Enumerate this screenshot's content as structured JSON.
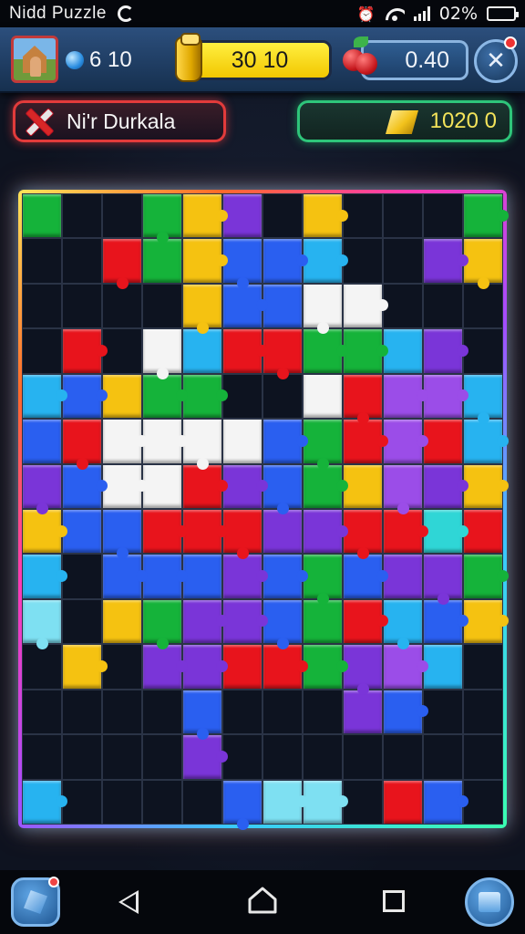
{
  "status_bar": {
    "app_title": "Nidd Puzzle",
    "battery_text": "02%"
  },
  "hud": {
    "coin_count": "6  10",
    "gold_value": "30 10",
    "berry_value": "0.40"
  },
  "level": {
    "name": "Ni'r Durkala"
  },
  "score": {
    "value": "1020 0"
  },
  "colors": {
    "board_bg": "#111827",
    "palette": {
      "R": "#e8141c",
      "G": "#15b33a",
      "B": "#2a5ff0",
      "C": "#27b3f0",
      "P": "#7a35d8",
      "V": "#9b4de8",
      "Y": "#f5c211",
      "W": "#f4f4f4",
      "L": "#7ee0f2",
      "K": "#0d1320",
      "A": "#2fd6d6",
      "T": "#8be02c"
    }
  },
  "board": {
    "columns": 12,
    "rows": 14,
    "cells": [
      "GKKGYPKYKKKG",
      "KKRGYBBCKKPY",
      "KKKKYBBWWKKK",
      "KRKWCRRGGCPK",
      "CBYGGKKWRVVC",
      "BRWWWWBGRVRC",
      "PBWWRPBGYVPY",
      "YBBRRRPPRRAR",
      "CKBBBPBGBPPG",
      "LKYGPPBGRCBY",
      "KYKPPRRGPVCK",
      "KKKKBKKKPBKK",
      "KKKKPKKKKKKK",
      "CKKKKBLLKRBK"
    ]
  }
}
